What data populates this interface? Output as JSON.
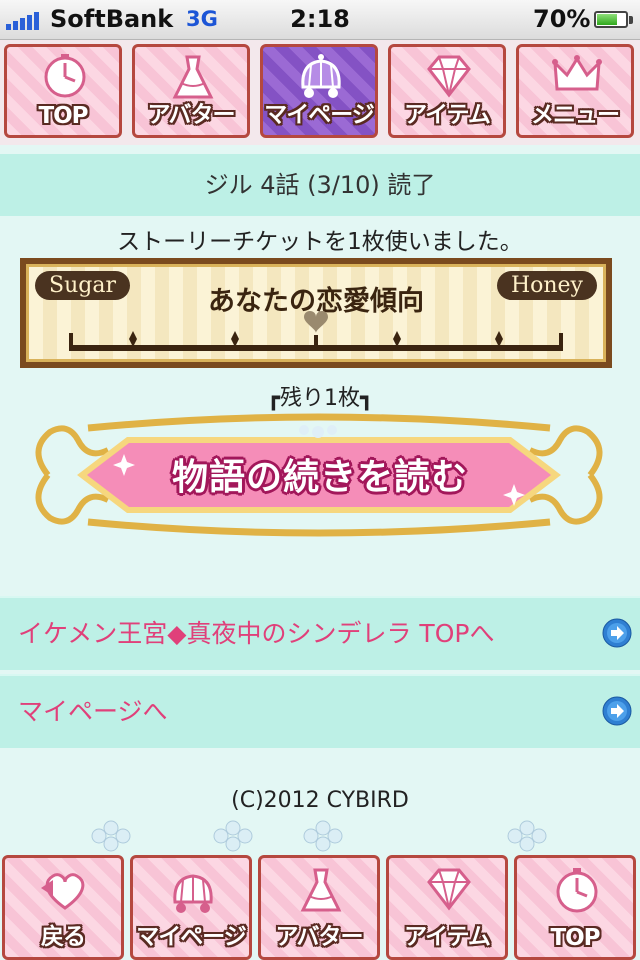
{
  "status_bar": {
    "carrier": "SoftBank",
    "network": "3G",
    "time": "2:18",
    "battery": "70%",
    "battery_level": 0.7
  },
  "top_nav": {
    "items": [
      {
        "label": "TOP",
        "icon": "clock-icon"
      },
      {
        "label": "アバター",
        "icon": "dress-icon"
      },
      {
        "label": "マイページ",
        "icon": "carriage-icon",
        "active": true
      },
      {
        "label": "アイテム",
        "icon": "diamond-icon"
      },
      {
        "label": "メニュー",
        "icon": "crown-icon"
      }
    ]
  },
  "header": {
    "title": "ジル 4話 (3/10) 読了"
  },
  "notice": "ストーリーチケットを1枚使いました。",
  "romance_meter": {
    "left_label": "Sugar",
    "right_label": "Honey",
    "title": "あなたの恋愛傾向",
    "position": 0.5
  },
  "tickets": {
    "remaining": "┏残り1枚┓"
  },
  "read_button": {
    "label": "物語の続きを読む"
  },
  "links": [
    {
      "label": "イケメン王宮◆真夜中のシンデレラ TOPへ"
    },
    {
      "label": "マイページへ"
    }
  ],
  "footer": {
    "copyright": "(C)2012 CYBIRD"
  },
  "bottom_nav": {
    "items": [
      {
        "label": "戻る",
        "icon": "back-heart-icon"
      },
      {
        "label": "マイページ",
        "icon": "carriage-icon"
      },
      {
        "label": "アバター",
        "icon": "dress-icon"
      },
      {
        "label": "アイテム",
        "icon": "diamond-icon"
      },
      {
        "label": "TOP",
        "icon": "clock-icon"
      }
    ]
  },
  "colors": {
    "link_pink": "#e0407a",
    "mint": "#bdf0e6",
    "active_purple": "#8452c4"
  }
}
